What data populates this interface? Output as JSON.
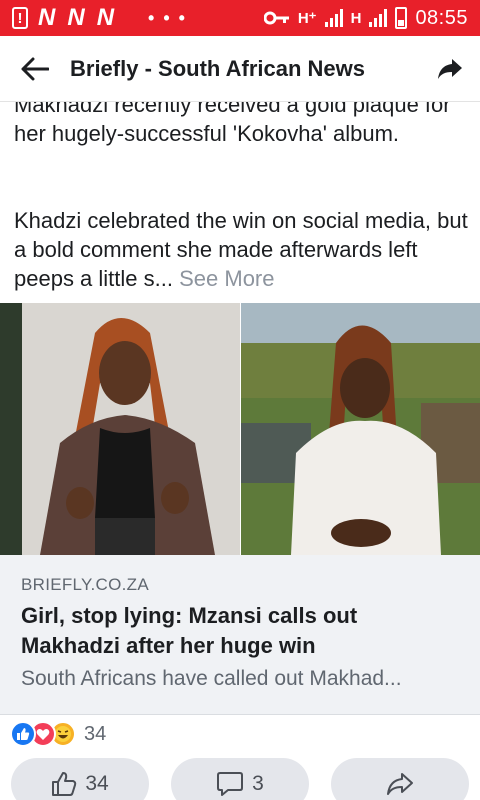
{
  "status_bar": {
    "network": "H⁺",
    "network2": "H",
    "time": "08:55"
  },
  "app_bar": {
    "title": "Briefly - South African News"
  },
  "post": {
    "paragraph1": "Makhadzi recently received a gold plaque for her hugely-successful 'Kokovha' album.",
    "paragraph2": "Khadzi celebrated the win on social media, but a bold comment she made afterwards left peeps a little s...",
    "see_more": "See More"
  },
  "link_preview": {
    "domain": "BRIEFLY.CO.ZA",
    "title": "Girl, stop lying: Mzansi calls out Makhadzi after her huge win",
    "description": "South Africans have called out Makhad..."
  },
  "reactions": {
    "types": [
      "like-icon",
      "love-icon",
      "haha-icon"
    ],
    "count": "34"
  },
  "actions": {
    "like_count": "34",
    "comment_count": "3"
  },
  "colors": {
    "status_bar": "#e8202a",
    "like_blue": "#1877f2"
  }
}
